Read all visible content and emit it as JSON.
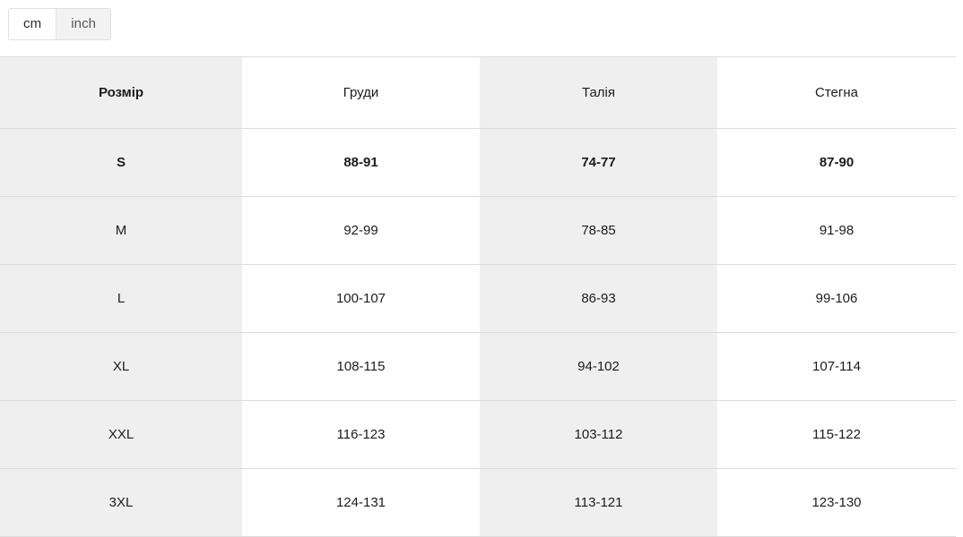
{
  "unit_toggle": {
    "name": "unit-toggle",
    "options": [
      {
        "label": "cm",
        "active": true
      },
      {
        "label": "inch",
        "active": false
      }
    ],
    "selected": "cm"
  },
  "size_table": {
    "columns": [
      "Розмір",
      "Груди",
      "Талія",
      "Стегна"
    ],
    "rows": [
      {
        "size": "S",
        "chest": "88-91",
        "waist": "74-77",
        "hips": "87-90",
        "highlighted": true
      },
      {
        "size": "M",
        "chest": "92-99",
        "waist": "78-85",
        "hips": "91-98",
        "highlighted": false
      },
      {
        "size": "L",
        "chest": "100-107",
        "waist": "86-93",
        "hips": "99-106",
        "highlighted": false
      },
      {
        "size": "XL",
        "chest": "108-115",
        "waist": "94-102",
        "hips": "107-114",
        "highlighted": false
      },
      {
        "size": "XXL",
        "chest": "116-123",
        "waist": "103-112",
        "hips": "115-122",
        "highlighted": false
      },
      {
        "size": "3XL",
        "chest": "124-131",
        "waist": "113-121",
        "hips": "123-130",
        "highlighted": false
      }
    ]
  },
  "colors": {
    "shaded_column": "#efefef",
    "border": "#dcdcdc",
    "text": "#1c1c1c",
    "toggle_inactive_bg": "#f2f2f2"
  }
}
